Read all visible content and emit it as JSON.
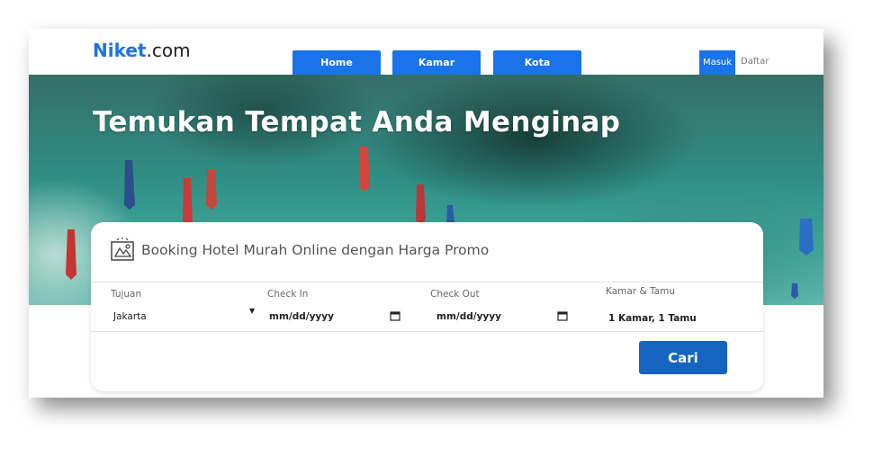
{
  "header": {
    "logo_brand": "Niket",
    "logo_suffix": ".com",
    "nav": [
      {
        "label": "Home"
      },
      {
        "label": "Kamar"
      },
      {
        "label": "Kota"
      }
    ],
    "login_label": "Masuk",
    "register_label": "Daftar"
  },
  "hero": {
    "title": "Temukan Tempat Anda Menginap"
  },
  "booking": {
    "icon": "hotel-booking-icon",
    "title": "Booking Hotel Murah Online dengan Harga Promo",
    "fields": {
      "destination": {
        "label": "Tujuan",
        "value": "Jakarta"
      },
      "checkin": {
        "label": "Check In",
        "value": "mm/dd/yyyy",
        "icon": "calendar-icon"
      },
      "checkout": {
        "label": "Check Out",
        "value": "mm/dd/yyyy",
        "icon": "calendar-icon"
      },
      "rooms_guests": {
        "label": "Kamar & Tamu",
        "value": "1 Kamar, 1 Tamu"
      }
    },
    "search_label": "Cari"
  },
  "colors": {
    "primary": "#1a73e8",
    "search_button": "#1565c0",
    "hero_water": "#2f8e85"
  }
}
